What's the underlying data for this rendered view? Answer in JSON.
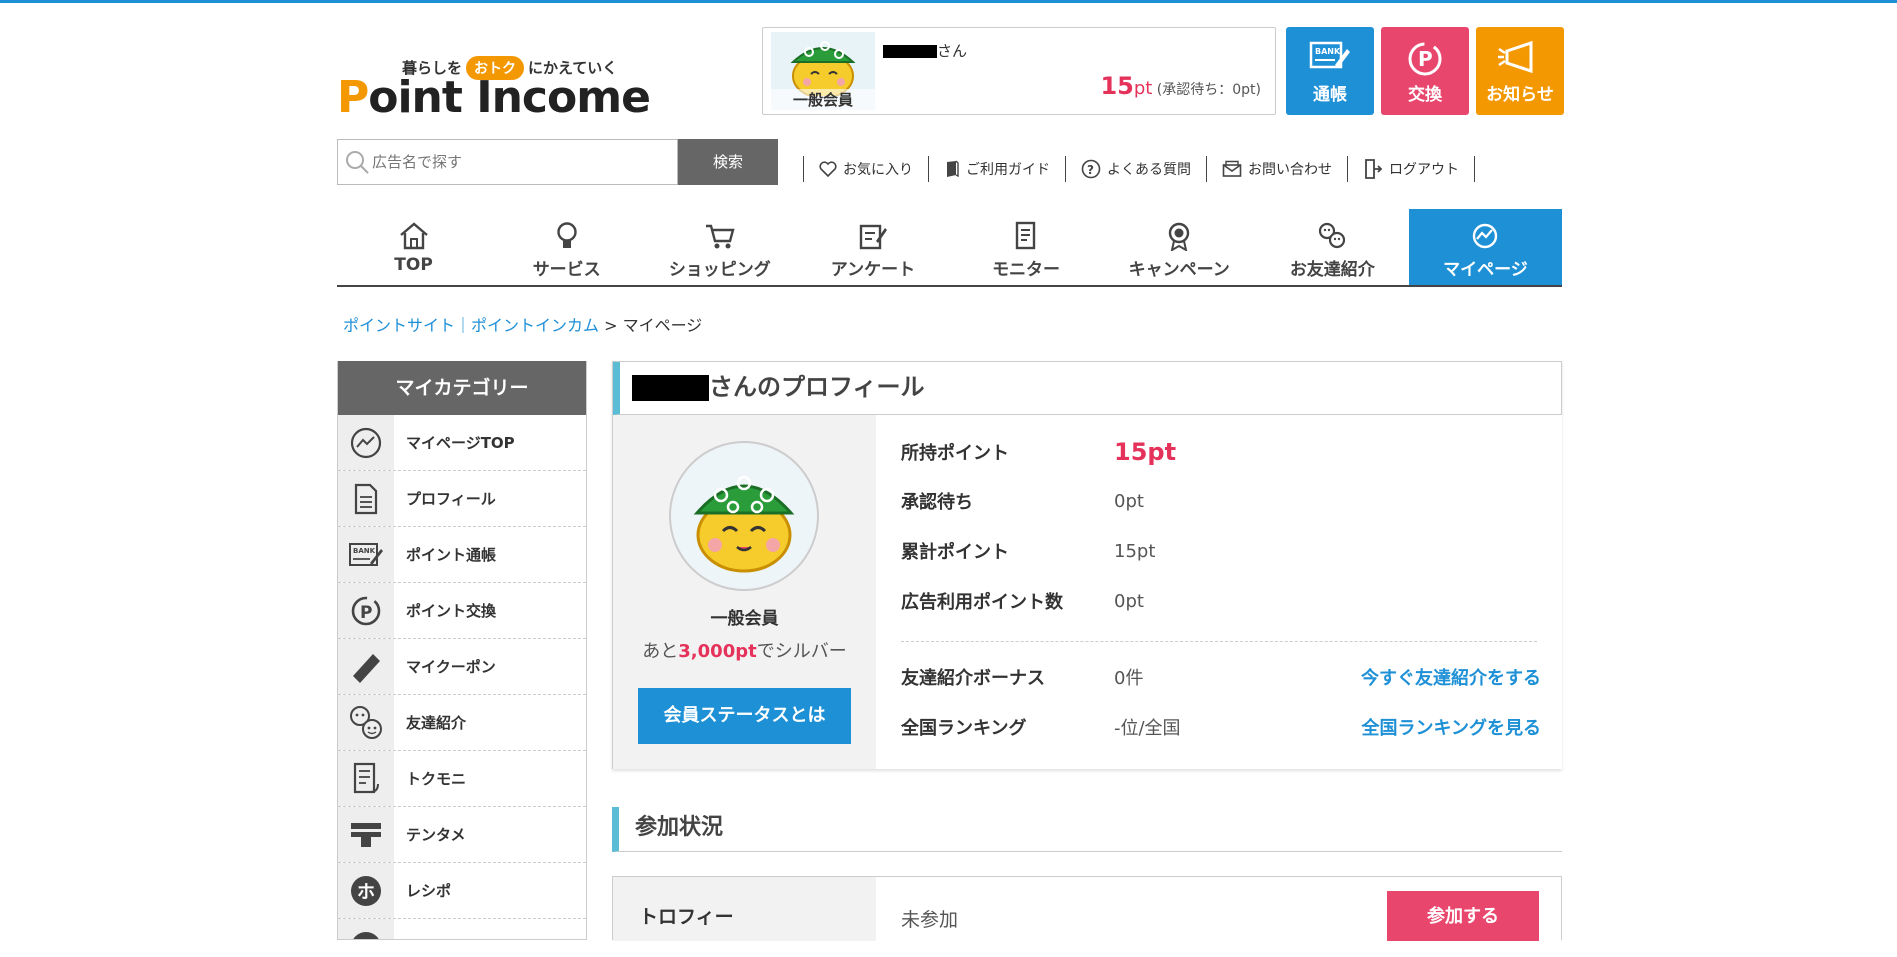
{
  "header": {
    "tagline_pre": "暮らしを",
    "tagline_mid": "おトク",
    "tagline_post": "にかえていく",
    "logo_first": "P",
    "logo_rest": "oint Income"
  },
  "user_card": {
    "rank": "一般会員",
    "san": "さん",
    "points": "15",
    "unit": "pt",
    "pending": "(承認待ち：0pt)"
  },
  "header_buttons": {
    "passbook": "通帳",
    "exchange": "交換",
    "notice": "お知らせ"
  },
  "search": {
    "placeholder": "広告名で探す",
    "button": "検索"
  },
  "util_links": [
    "お気に入り",
    "ご利用ガイド",
    "よくある質問",
    "お問い合わせ",
    "ログアウト"
  ],
  "nav": [
    "TOP",
    "サービス",
    "ショッピング",
    "アンケート",
    "モニター",
    "キャンペーン",
    "お友達紹介",
    "マイページ"
  ],
  "breadcrumb": {
    "link": "ポイントサイト｜ポイントインカム",
    "sep": ">",
    "current": "マイページ"
  },
  "sidebar": {
    "title": "マイカテゴリー",
    "items": [
      "マイページTOP",
      "プロフィール",
      "ポイント通帳",
      "ポイント交換",
      "マイクーポン",
      "友達紹介",
      "トクモニ",
      "テンタメ",
      "レシポ"
    ]
  },
  "profile": {
    "title_suffix": "さんのプロフィール",
    "rank": "一般会員",
    "next_pre": "あと",
    "next_amount": "3,000pt",
    "next_post": "でシルバー",
    "status_button": "会員ステータスとは",
    "rows": [
      {
        "key": "所持ポイント",
        "value": "15pt"
      },
      {
        "key": "承認待ち",
        "value": "0pt"
      },
      {
        "key": "累計ポイント",
        "value": "15pt"
      },
      {
        "key": "広告利用ポイント数",
        "value": "0pt"
      },
      {
        "key": "友達紹介ボーナス",
        "value": "0件",
        "link": "今すぐ友達紹介をする"
      },
      {
        "key": "全国ランキング",
        "value": "-位/全国",
        "link": "全国ランキングを見る"
      }
    ]
  },
  "participation": {
    "title": "参加状況",
    "row_key": "トロフィー",
    "row_value": "未参加",
    "button": "参加する"
  },
  "colors": {
    "accent_blue": "#1e90d6",
    "accent_pink": "#e8466d",
    "accent_orange": "#f39800",
    "points_red": "#e5325b"
  }
}
